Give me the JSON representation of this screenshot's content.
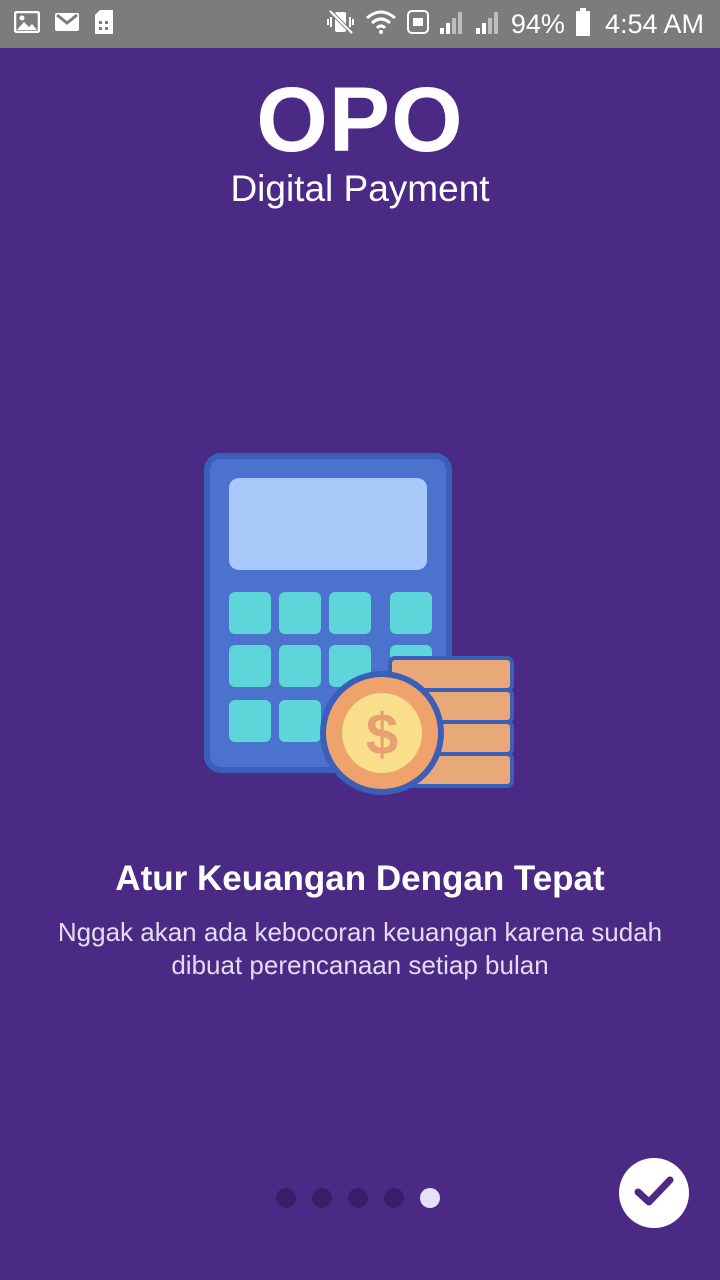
{
  "status_bar": {
    "battery_percent": "94%",
    "time": "4:54 AM",
    "left_icons": [
      "image-icon",
      "gmail-icon",
      "sim-icon"
    ],
    "right_icons": [
      "vibrate-icon",
      "wifi-icon",
      "lte-icon",
      "signal-icon",
      "signal-icon",
      "battery-icon"
    ]
  },
  "header": {
    "brand": "OPO",
    "subtitle": "Digital Payment"
  },
  "slide": {
    "illustration": "calculator-coins-icon",
    "title": "Atur Keuangan Dengan Tepat",
    "description": "Nggak akan ada kebocoran keuangan karena sudah dibuat perencanaan setiap bulan"
  },
  "pager": {
    "total": 5,
    "active_index": 4
  },
  "done_button": {
    "icon": "check-icon"
  },
  "colors": {
    "background": "#4B2A86",
    "status_bar": "#7C7C7C",
    "dot_inactive": "#3A1E6A",
    "dot_active": "#E8E0F5",
    "accent": "#4B2A86"
  }
}
